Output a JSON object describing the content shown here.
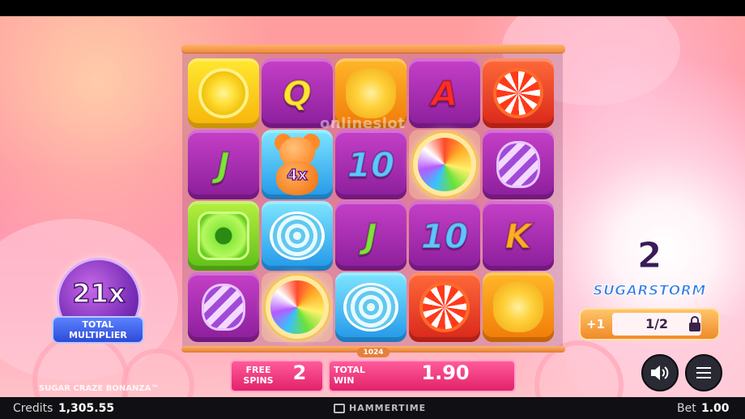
{
  "game": {
    "title": "SUGAR CRAZE BONANZA™",
    "watermark": "onlineslot",
    "ways_label": "1024"
  },
  "grid": [
    [
      {
        "symbol": "lemon-candy",
        "label": ""
      },
      {
        "symbol": "letter-j",
        "label": "J"
      },
      {
        "symbol": "green-square-candy",
        "label": ""
      },
      {
        "symbol": "striped-gumdrop",
        "label": ""
      }
    ],
    [
      {
        "symbol": "letter-q",
        "label": "Q"
      },
      {
        "symbol": "gummy-bear-multiplier",
        "label": "4x"
      },
      {
        "symbol": "blue-swirl-candy",
        "label": ""
      },
      {
        "symbol": "rainbow-lollipop-wild",
        "label": ""
      }
    ],
    [
      {
        "symbol": "orange-flower-candy",
        "label": ""
      },
      {
        "symbol": "number-10",
        "label": "10"
      },
      {
        "symbol": "letter-j",
        "label": "J"
      },
      {
        "symbol": "blue-swirl-candy",
        "label": ""
      }
    ],
    [
      {
        "symbol": "letter-a",
        "label": "A"
      },
      {
        "symbol": "rainbow-lollipop-wild",
        "label": ""
      },
      {
        "symbol": "number-10",
        "label": "10"
      },
      {
        "symbol": "red-peppermint-candy",
        "label": ""
      }
    ],
    [
      {
        "symbol": "red-peppermint-candy",
        "label": ""
      },
      {
        "symbol": "striped-gumdrop",
        "label": ""
      },
      {
        "symbol": "letter-k",
        "label": "K"
      },
      {
        "symbol": "orange-flower-candy",
        "label": ""
      }
    ]
  ],
  "multiplier": {
    "value": "21x",
    "label_line1": "TOTAL",
    "label_line2": "MULTIPLIER"
  },
  "sugar_storm": {
    "count": "2",
    "title": "SUGARSTORM",
    "increment": "+1",
    "progress_text": "1/2",
    "progress_fraction": 0.5
  },
  "free_spins": {
    "label_line1": "FREE",
    "label_line2": "SPINS",
    "value": "2"
  },
  "total_win": {
    "label_line1": "TOTAL",
    "label_line2": "WIN",
    "value": "1.90"
  },
  "footer": {
    "credits_label": "Credits",
    "credits_value": "1,305.55",
    "brand": "HAMMERTIME",
    "bet_label": "Bet",
    "bet_value": "1.00"
  },
  "colors": {
    "accent_pink": "#e2226a",
    "multiplier_purple": "#7a2eb8",
    "storm_blue": "#2f7de8"
  }
}
